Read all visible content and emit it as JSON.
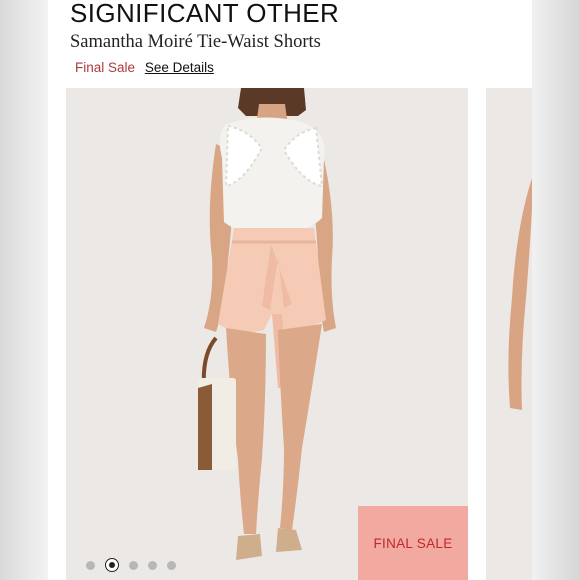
{
  "brand": "SIGNIFICANT OTHER",
  "product_name": "Samantha Moiré Tie-Waist Shorts",
  "final_sale_label": "Final Sale",
  "details_link": "See Details",
  "badge": "FINAL SALE",
  "gallery": {
    "slide_count": 5,
    "active_index": 1
  },
  "colors": {
    "accent_red": "#b03a3a",
    "badge_bg": "#f2aaa0",
    "badge_text": "#c1272d",
    "photo_bg": "#ece8e6"
  }
}
